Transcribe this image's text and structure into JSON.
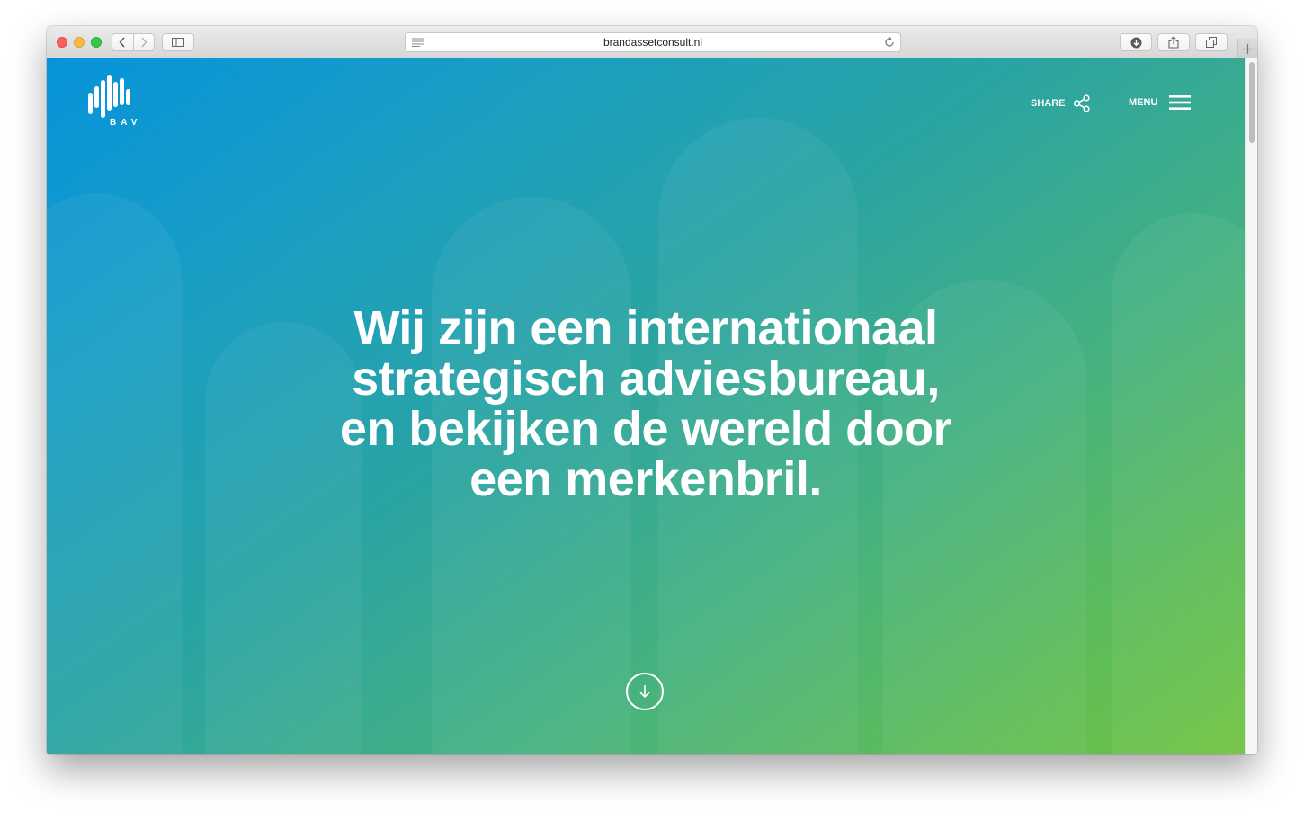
{
  "browser": {
    "url": "brandassetconsult.nl"
  },
  "header": {
    "logo_text": "BAV",
    "share_label": "SHARE",
    "menu_label": "MENU"
  },
  "hero": {
    "headline_lines": [
      "Wij zijn een internationaal",
      "strategisch adviesbureau,",
      "en bekijken de wereld door",
      "een merkenbril."
    ]
  },
  "icons": {
    "back": "chevron-left-icon",
    "forward": "chevron-right-icon",
    "sidebar": "sidebar-icon",
    "reader": "reader-icon",
    "reload": "reload-icon",
    "download": "download-icon",
    "share_browser": "share-icon",
    "tabs": "tabs-icon",
    "new_tab": "plus-icon",
    "share_page": "share-nodes-icon",
    "menu": "hamburger-icon",
    "scroll_down": "arrow-down-icon"
  },
  "colors": {
    "gradient_start": "#0693da",
    "gradient_end": "#72c441",
    "text": "#ffffff"
  }
}
